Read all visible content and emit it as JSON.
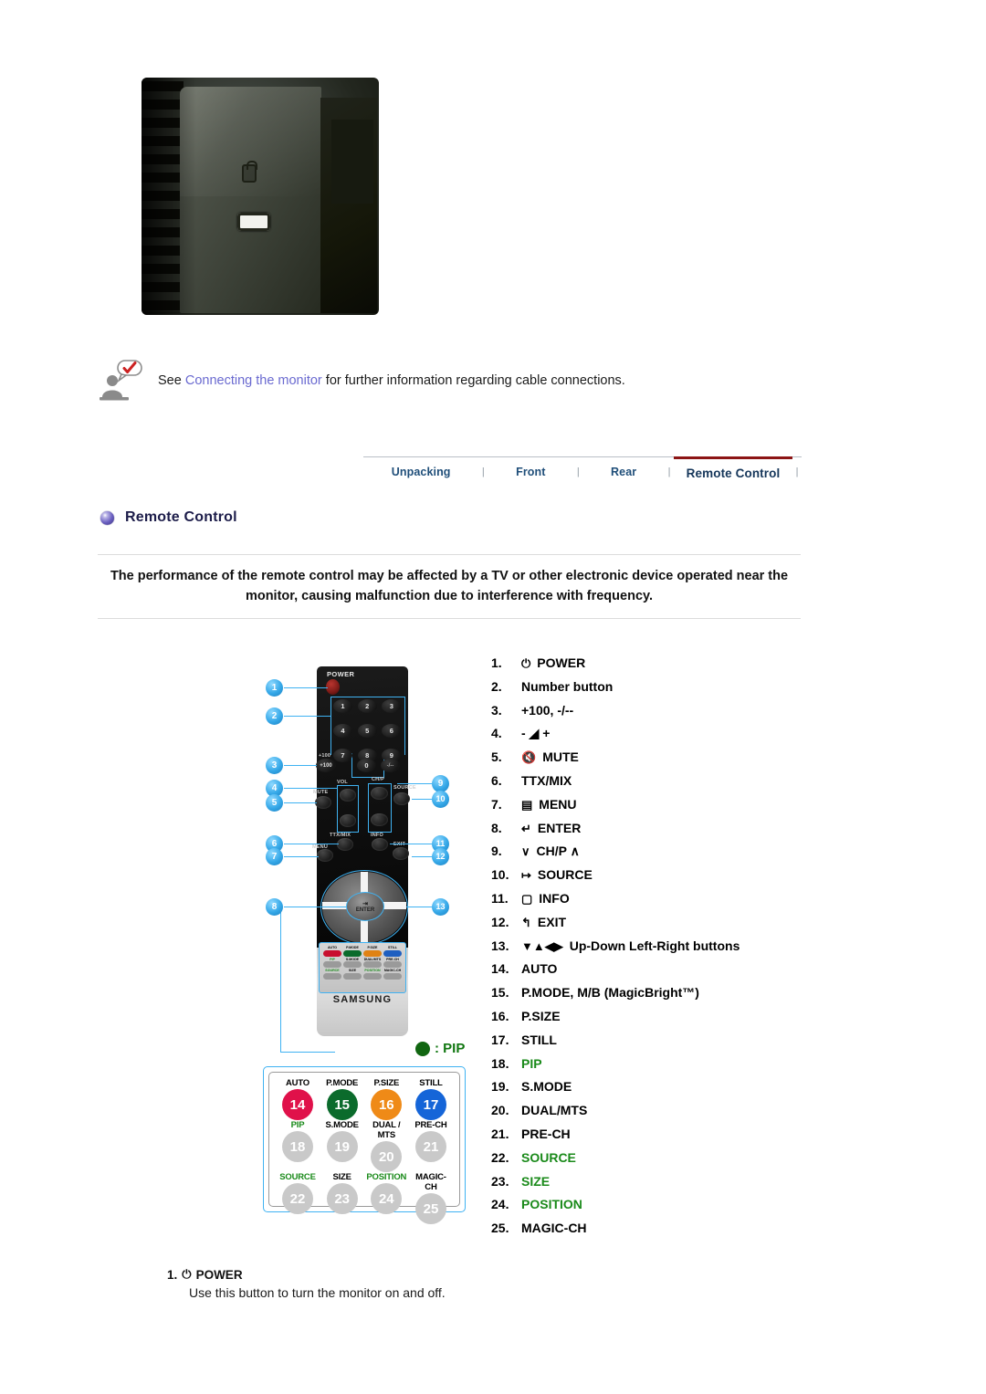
{
  "note": {
    "icon": "note-person-check-icon",
    "prefix": "See ",
    "link": "Connecting the monitor",
    "suffix": " for further information regarding cable connections."
  },
  "tabs": [
    {
      "label": "Unpacking",
      "active": false
    },
    {
      "label": "Front",
      "active": false
    },
    {
      "label": "Rear",
      "active": false
    },
    {
      "label": "Remote Control",
      "active": true
    }
  ],
  "tab_separator": "|",
  "section": {
    "title": "Remote Control",
    "bullet_color": "#6a5fc0"
  },
  "warning": "The performance of the remote control may be affected by a TV or other electronic device operated near the monitor, causing malfunction due to interference with frequency.",
  "remote": {
    "power_label": "POWER",
    "keys": [
      "1",
      "2",
      "3",
      "4",
      "5",
      "6",
      "7",
      "8",
      "9"
    ],
    "key_zero": "0",
    "key_plus100": "+100",
    "key_minus": "-/--",
    "label_plus100_top": "+100",
    "label_vol": "VOL",
    "label_chp": "CH/P",
    "label_mute": "MUTE",
    "label_source": "SOURCE",
    "label_ttxmix": "TTX/MIX",
    "label_info": "INFO",
    "label_menu": "MENU",
    "label_exit": "EXIT",
    "enter_label": "ENTER",
    "brand": "SAMSUNG",
    "mini_rows": [
      {
        "caps": [
          "AUTO",
          "P.MODE",
          "P.SIZE",
          "STILL"
        ],
        "colors": [
          "#c8102e",
          "#0b6b2c",
          "#e08214",
          "#1f5fc0"
        ]
      },
      {
        "caps": [
          "PIP",
          "S.MODE",
          "DUAL/MTS",
          "PRE-CH"
        ],
        "colors": [
          "#9a9a9a",
          "#9a9a9a",
          "#9a9a9a",
          "#9a9a9a"
        ]
      },
      {
        "caps": [
          "SOURCE",
          "SIZE",
          "POSITION",
          "MAGIC-CH"
        ],
        "colors": [
          "#9a9a9a",
          "#9a9a9a",
          "#9a9a9a",
          "#9a9a9a"
        ]
      }
    ],
    "badges_left": [
      "1",
      "2",
      "3",
      "4",
      "5",
      "6",
      "7",
      "8"
    ],
    "badges_right": [
      "9",
      "10",
      "11",
      "12",
      "13"
    ]
  },
  "pip_legend": {
    "dot_color": "#116611",
    "text": ": PIP"
  },
  "zoom_panel": {
    "rows": [
      {
        "cells": [
          {
            "cap": "AUTO",
            "cap_color": "#000000",
            "num": "14",
            "color": "#e0114a"
          },
          {
            "cap": "P.MODE",
            "cap_color": "#000000",
            "num": "15",
            "color": "#0b6b2c"
          },
          {
            "cap": "P.SIZE",
            "cap_color": "#000000",
            "num": "16",
            "color": "#ef8a17"
          },
          {
            "cap": "STILL",
            "cap_color": "#000000",
            "num": "17",
            "color": "#1565d8"
          }
        ]
      },
      {
        "cells": [
          {
            "cap": "PIP",
            "cap_color": "#1a8a1a",
            "num": "18",
            "color": "#c9c9c9"
          },
          {
            "cap": "S.MODE",
            "cap_color": "#000000",
            "num": "19",
            "color": "#c9c9c9"
          },
          {
            "cap": "DUAL / MTS",
            "cap_color": "#000000",
            "num": "20",
            "color": "#c9c9c9"
          },
          {
            "cap": "PRE-CH",
            "cap_color": "#000000",
            "num": "21",
            "color": "#c9c9c9"
          }
        ]
      },
      {
        "cells": [
          {
            "cap": "SOURCE",
            "cap_color": "#1a8a1a",
            "num": "22",
            "color": "#c9c9c9"
          },
          {
            "cap": "SIZE",
            "cap_color": "#000000",
            "num": "23",
            "color": "#c9c9c9"
          },
          {
            "cap": "POSITION",
            "cap_color": "#1a8a1a",
            "num": "24",
            "color": "#c9c9c9"
          },
          {
            "cap": "MAGIC-CH",
            "cap_color": "#000000",
            "num": "25",
            "color": "#c9c9c9"
          }
        ]
      }
    ]
  },
  "legend_items": [
    {
      "num": "1.",
      "icon": "power-icon",
      "glyph": "⏻",
      "label": "POWER",
      "color": "#000000"
    },
    {
      "num": "2.",
      "icon": "",
      "glyph": "",
      "label": "Number button",
      "color": "#000000"
    },
    {
      "num": "3.",
      "icon": "",
      "glyph": "",
      "label": "+100, -/--",
      "color": "#000000"
    },
    {
      "num": "4.",
      "icon": "volume-icon",
      "glyph": "",
      "label": "-  ◢  +",
      "color": "#000000"
    },
    {
      "num": "5.",
      "icon": "mute-icon",
      "glyph": "🔇",
      "label": "MUTE",
      "color": "#000000"
    },
    {
      "num": "6.",
      "icon": "",
      "glyph": "",
      "label": "TTX/MIX",
      "color": "#000000"
    },
    {
      "num": "7.",
      "icon": "menu-icon",
      "glyph": "▤",
      "label": "MENU",
      "color": "#000000"
    },
    {
      "num": "8.",
      "icon": "enter-icon",
      "glyph": "↵",
      "label": "ENTER",
      "color": "#000000"
    },
    {
      "num": "9.",
      "icon": "chp-icon",
      "glyph": "∨",
      "label": "CH/P ∧",
      "color": "#000000"
    },
    {
      "num": "10.",
      "icon": "source-icon",
      "glyph": "↦",
      "label": "SOURCE",
      "color": "#000000"
    },
    {
      "num": "11.",
      "icon": "info-icon",
      "glyph": "▢",
      "label": "INFO",
      "color": "#000000"
    },
    {
      "num": "12.",
      "icon": "exit-icon",
      "glyph": "↰",
      "label": "EXIT",
      "color": "#000000"
    },
    {
      "num": "13.",
      "icon": "arrows-icon",
      "glyph": "▼▲◀▶",
      "label": "Up-Down Left-Right buttons",
      "color": "#000000"
    },
    {
      "num": "14.",
      "icon": "",
      "glyph": "",
      "label": "AUTO",
      "color": "#000000"
    },
    {
      "num": "15.",
      "icon": "",
      "glyph": "",
      "label": "P.MODE, M/B (MagicBright™)",
      "color": "#000000"
    },
    {
      "num": "16.",
      "icon": "",
      "glyph": "",
      "label": "P.SIZE",
      "color": "#000000"
    },
    {
      "num": "17.",
      "icon": "",
      "glyph": "",
      "label": "STILL",
      "color": "#000000"
    },
    {
      "num": "18.",
      "icon": "",
      "glyph": "",
      "label": "PIP",
      "color": "#1a8a1a"
    },
    {
      "num": "19.",
      "icon": "",
      "glyph": "",
      "label": "S.MODE",
      "color": "#000000"
    },
    {
      "num": "20.",
      "icon": "",
      "glyph": "",
      "label": "DUAL/MTS",
      "color": "#000000"
    },
    {
      "num": "21.",
      "icon": "",
      "glyph": "",
      "label": "PRE-CH",
      "color": "#000000"
    },
    {
      "num": "22.",
      "icon": "",
      "glyph": "",
      "label": "SOURCE",
      "color": "#1a8a1a"
    },
    {
      "num": "23.",
      "icon": "",
      "glyph": "",
      "label": "SIZE",
      "color": "#1a8a1a"
    },
    {
      "num": "24.",
      "icon": "",
      "glyph": "",
      "label": "POSITION",
      "color": "#1a8a1a"
    },
    {
      "num": "25.",
      "icon": "",
      "glyph": "",
      "label": "MAGIC-CH",
      "color": "#000000"
    }
  ],
  "description": {
    "num": "1.",
    "glyph": "⏻",
    "title": "POWER",
    "body": "Use this button to turn the monitor on and off."
  }
}
